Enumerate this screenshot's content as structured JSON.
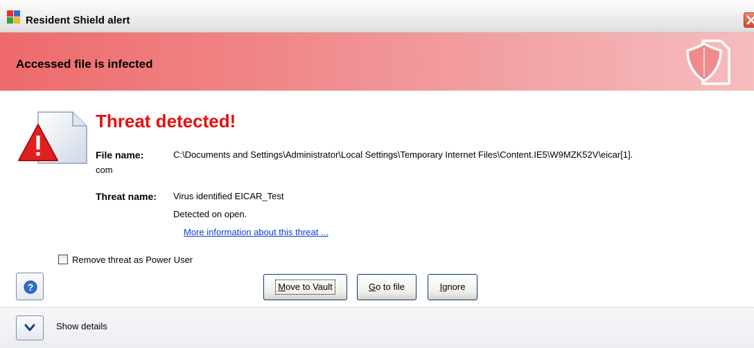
{
  "window": {
    "title": "Resident Shield alert",
    "close_icon": "close-icon",
    "app_icon": "avg-logo-icon"
  },
  "banner": {
    "text": "Accessed file is infected",
    "icon": "shield-document-icon",
    "color": "#ee6a6c"
  },
  "alert": {
    "icon": "warning-document-icon",
    "title": "Threat detected!",
    "title_color": "#e41010",
    "file_label": "File name:",
    "file_path_line1": "C:\\Documents and Settings\\Administrator\\Local Settings\\Temporary Internet Files\\Content.IE5\\W9MZK52V\\eicar[1].",
    "file_path_line2": "com",
    "threat_label": "Threat name:",
    "threat_name": "Virus identified EICAR_Test",
    "detected_text": "Detected on open.",
    "more_info_link": "More information about this threat ..."
  },
  "options": {
    "remove_as_power_user_label": "Remove threat as Power User",
    "remove_as_power_user_checked": false
  },
  "buttons": {
    "help_icon": "help-icon",
    "move_to_vault": {
      "mnemonic": "M",
      "rest": "ove to Vault"
    },
    "go_to_file": {
      "mnemonic": "G",
      "rest": "o to file"
    },
    "ignore": {
      "mnemonic": "I",
      "rest": "gnore"
    }
  },
  "footer": {
    "details_icon": "chevron-down-icon",
    "show_details_label": "Show details"
  }
}
